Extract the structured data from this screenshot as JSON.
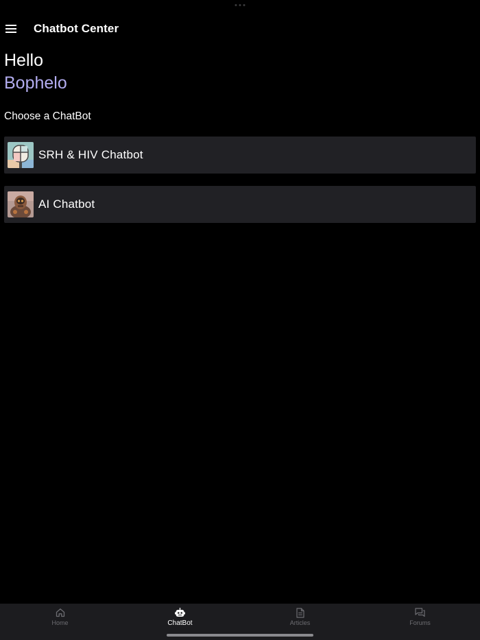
{
  "app_bar": {
    "title": "Chatbot Center"
  },
  "greeting": {
    "hello": "Hello",
    "username": "Bophelo",
    "username_color": "#b3adf0"
  },
  "choose_label": "Choose a ChatBot",
  "chatbots": [
    {
      "name": "SRH & HIV Chatbot",
      "avatar": "srh-hiv-bot-avatar"
    },
    {
      "name": "AI Chatbot",
      "avatar": "ai-robot-avatar"
    }
  ],
  "tab_bar": {
    "tabs": [
      {
        "label": "Home",
        "icon": "home-icon",
        "active": false
      },
      {
        "label": "ChatBot",
        "icon": "robot-icon",
        "active": true
      },
      {
        "label": "Articles",
        "icon": "document-icon",
        "active": false
      },
      {
        "label": "Forums",
        "icon": "chat-bubbles-icon",
        "active": false
      }
    ]
  },
  "colors": {
    "background": "#000000",
    "card": "#212125",
    "tab_bar": "#1c1c1f",
    "inactive_tab": "#6d6d72"
  }
}
